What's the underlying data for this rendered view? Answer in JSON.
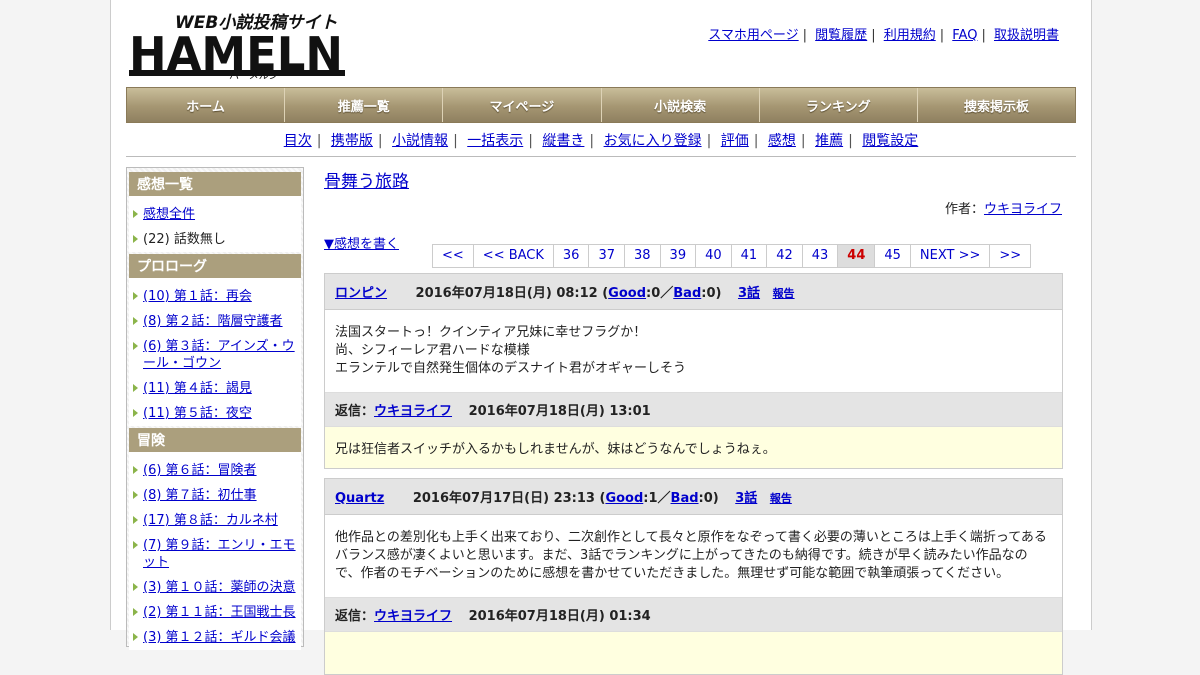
{
  "logo": {
    "main": "HAMELN",
    "tagline": "WEB小説投稿サイト",
    "kana": "ハーメルン"
  },
  "toplinks": [
    "スマホ用ページ",
    "閲覧履歴",
    "利用規約",
    "FAQ",
    "取扱説明書"
  ],
  "gnav": [
    "ホーム",
    "推薦一覧",
    "マイページ",
    "小説検索",
    "ランキング",
    "捜索掲示板"
  ],
  "subnav": [
    "目次",
    "携帯版",
    "小説情報",
    "一括表示",
    "縦書き",
    "お気に入り登録",
    "評価",
    "感想",
    "推薦",
    "閲覧設定"
  ],
  "sidebar": {
    "sections": [
      {
        "title": "感想一覧",
        "items": [
          {
            "label": "感想全件",
            "link": true
          },
          {
            "label": "(22) 話数無し",
            "link": false
          }
        ]
      },
      {
        "title": "プロローグ",
        "items": [
          {
            "label": "(10) 第１話：再会",
            "link": true
          },
          {
            "label": "(8) 第２話：階層守護者",
            "link": true
          },
          {
            "label": "(6) 第３話：アインズ・ウール・ゴウン",
            "link": true
          },
          {
            "label": "(11) 第４話：謁見",
            "link": true
          },
          {
            "label": "(11) 第５話：夜空",
            "link": true
          }
        ]
      },
      {
        "title": "冒険",
        "items": [
          {
            "label": "(6) 第６話：冒険者",
            "link": true
          },
          {
            "label": "(8) 第７話：初仕事",
            "link": true
          },
          {
            "label": "(17) 第８話：カルネ村",
            "link": true
          },
          {
            "label": "(7) 第９話：エンリ・エモット",
            "link": true
          },
          {
            "label": "(3) 第１０話：薬師の決意",
            "link": true
          },
          {
            "label": "(2) 第１１話：王国戦士長",
            "link": true
          },
          {
            "label": "(3) 第１２話：ギルド会議",
            "link": true
          }
        ]
      }
    ]
  },
  "main": {
    "title": "骨舞う旅路",
    "author_label": "作者：",
    "author": "ウキヨライフ",
    "write_link": "▼感想を書く",
    "pager": [
      "<<",
      "<< BACK",
      "36",
      "37",
      "38",
      "39",
      "40",
      "41",
      "42",
      "43",
      "44",
      "45",
      "NEXT >>",
      ">>"
    ],
    "pager_current": "44"
  },
  "comments": [
    {
      "user": "ロンピン",
      "date": "2016年07月18日(月) 08:12",
      "good_label": "Good",
      "good": ":0／",
      "bad_label": "Bad",
      "bad": ":0)",
      "episode": "3話",
      "report": "報告",
      "body": [
        "法国スタートっ！クインティア兄妹に幸せフラグか！",
        "尚、シフィーレア君ハードな模様",
        "エランテルで自然発生個体のデスナイト君がオギャーしそう"
      ],
      "reply_label": "返信：",
      "reply_user": "ウキヨライフ",
      "reply_date": "2016年07月18日(月) 13:01",
      "reply": "兄は狂信者スイッチが入るかもしれませんが、妹はどうなんでしょうねぇ。"
    },
    {
      "user": "Quartz",
      "date": "2016年07月17日(日) 23:13",
      "good_label": "Good",
      "good": ":1／",
      "bad_label": "Bad",
      "bad": ":0)",
      "episode": "3話",
      "report": "報告",
      "body": [
        "他作品との差別化も上手く出来ており、二次創作として長々と原作をなぞって書く必要の薄いところは上手く端折ってあるバランス感が凄くよいと思います。まだ、3話でランキングに上がってきたのも納得です。続きが早く読みたい作品なので、作者のモチベーションのために感想を書かせていただきました。無理せず可能な範囲で執筆頑張ってください。"
      ],
      "reply_label": "返信：",
      "reply_user": "ウキヨライフ",
      "reply_date": "2016年07月18日(月) 01:34",
      "reply": ""
    }
  ]
}
